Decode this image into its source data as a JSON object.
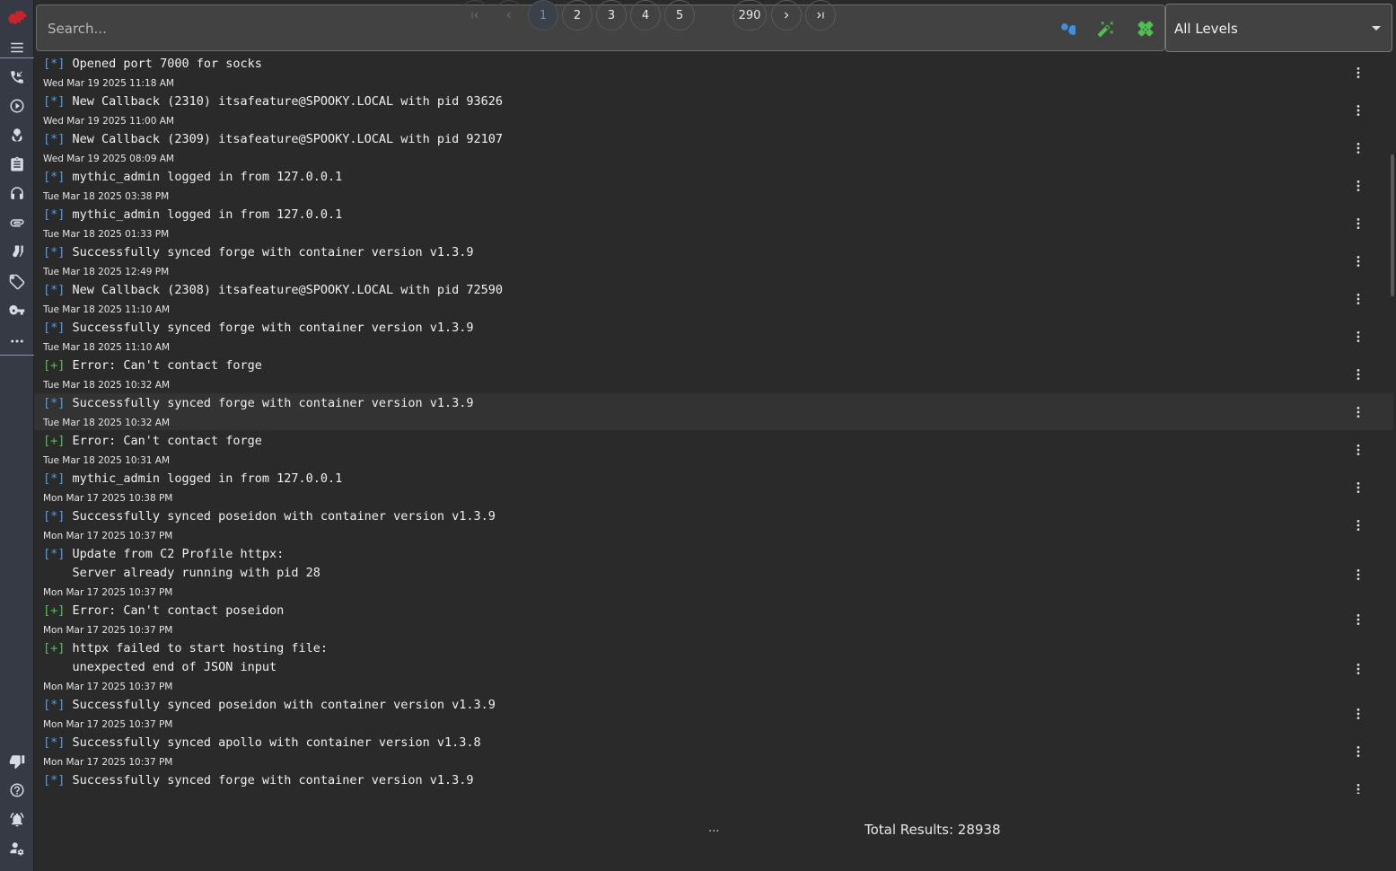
{
  "search": {
    "placeholder": "Search..."
  },
  "level_select": {
    "selected": "All Levels"
  },
  "sidebar": {
    "items": [
      "logo-icon",
      "menu-icon",
      "phone-callback-icon",
      "play-circle-icon",
      "biohazard-icon",
      "clipboard-icon",
      "headphones-icon",
      "attachment-icon",
      "socks-icon",
      "tag-icon",
      "key-icon",
      "more-icon",
      "thumbs-down-icon",
      "help-icon",
      "alarm-icon",
      "user-settings-icon"
    ]
  },
  "log": {
    "entries": [
      {
        "tag": "[*]",
        "tag_color": "#4f9be8",
        "lines": [
          "Opened port 7000 for socks"
        ],
        "time": "Wed Mar 19 2025 11:18 AM"
      },
      {
        "tag": "[*]",
        "tag_color": "#4f9be8",
        "lines": [
          "New Callback (2310) itsafeature@SPOOKY.LOCAL with pid 93626"
        ],
        "time": "Wed Mar 19 2025 11:00 AM"
      },
      {
        "tag": "[*]",
        "tag_color": "#4f9be8",
        "lines": [
          "New Callback (2309) itsafeature@SPOOKY.LOCAL with pid 92107"
        ],
        "time": "Wed Mar 19 2025 08:09 AM"
      },
      {
        "tag": "[*]",
        "tag_color": "#4f9be8",
        "lines": [
          "mythic_admin logged in from 127.0.0.1"
        ],
        "time": "Tue Mar 18 2025 03:38 PM"
      },
      {
        "tag": "[*]",
        "tag_color": "#4f9be8",
        "lines": [
          "mythic_admin logged in from 127.0.0.1"
        ],
        "time": "Tue Mar 18 2025 01:33 PM"
      },
      {
        "tag": "[*]",
        "tag_color": "#4f9be8",
        "lines": [
          "Successfully synced forge with container version v1.3.9"
        ],
        "time": "Tue Mar 18 2025 12:49 PM"
      },
      {
        "tag": "[*]",
        "tag_color": "#4f9be8",
        "lines": [
          "New Callback (2308) itsafeature@SPOOKY.LOCAL with pid 72590"
        ],
        "time": "Tue Mar 18 2025 11:10 AM"
      },
      {
        "tag": "[*]",
        "tag_color": "#4f9be8",
        "lines": [
          "Successfully synced forge with container version v1.3.9"
        ],
        "time": "Tue Mar 18 2025 11:10 AM"
      },
      {
        "tag": "[+]",
        "tag_color": "#4fc04f",
        "lines": [
          "Error: Can't contact forge"
        ],
        "time": "Tue Mar 18 2025 10:32 AM"
      },
      {
        "tag": "[*]",
        "tag_color": "#4f9be8",
        "lines": [
          "Successfully synced forge with container version v1.3.9"
        ],
        "time": "Tue Mar 18 2025 10:32 AM"
      },
      {
        "tag": "[+]",
        "tag_color": "#4fc04f",
        "lines": [
          "Error: Can't contact forge"
        ],
        "time": "Tue Mar 18 2025 10:31 AM"
      },
      {
        "tag": "[*]",
        "tag_color": "#4f9be8",
        "lines": [
          "mythic_admin logged in from 127.0.0.1"
        ],
        "time": "Mon Mar 17 2025 10:38 PM"
      },
      {
        "tag": "[*]",
        "tag_color": "#4f9be8",
        "lines": [
          "Successfully synced poseidon with container version v1.3.9"
        ],
        "time": "Mon Mar 17 2025 10:37 PM"
      },
      {
        "tag": "[*]",
        "tag_color": "#4f9be8",
        "lines": [
          "Update from C2 Profile httpx:",
          "Server already running with pid 28"
        ],
        "time": "Mon Mar 17 2025 10:37 PM"
      },
      {
        "tag": "[+]",
        "tag_color": "#4fc04f",
        "lines": [
          "Error: Can't contact poseidon"
        ],
        "time": "Mon Mar 17 2025 10:37 PM"
      },
      {
        "tag": "[+]",
        "tag_color": "#4fc04f",
        "lines": [
          "httpx failed to start hosting file:",
          "unexpected end of JSON input"
        ],
        "time": "Mon Mar 17 2025 10:37 PM"
      },
      {
        "tag": "[*]",
        "tag_color": "#4f9be8",
        "lines": [
          "Successfully synced poseidon with container version v1.3.9"
        ],
        "time": "Mon Mar 17 2025 10:37 PM"
      },
      {
        "tag": "[*]",
        "tag_color": "#4f9be8",
        "lines": [
          "Successfully synced apollo with container version v1.3.8"
        ],
        "time": "Mon Mar 17 2025 10:37 PM"
      },
      {
        "tag": "[*]",
        "tag_color": "#4f9be8",
        "lines": [
          "Successfully synced forge with container version v1.3.9"
        ],
        "time": "Mon Mar 17 2025 10:37 PM"
      }
    ],
    "highlighted_index": 9
  },
  "pagination": {
    "current": "1",
    "pages": [
      "1",
      "2",
      "3",
      "4",
      "5"
    ],
    "ellipsis": "...",
    "last": "290",
    "total_label": "Total Results: 28938"
  }
}
